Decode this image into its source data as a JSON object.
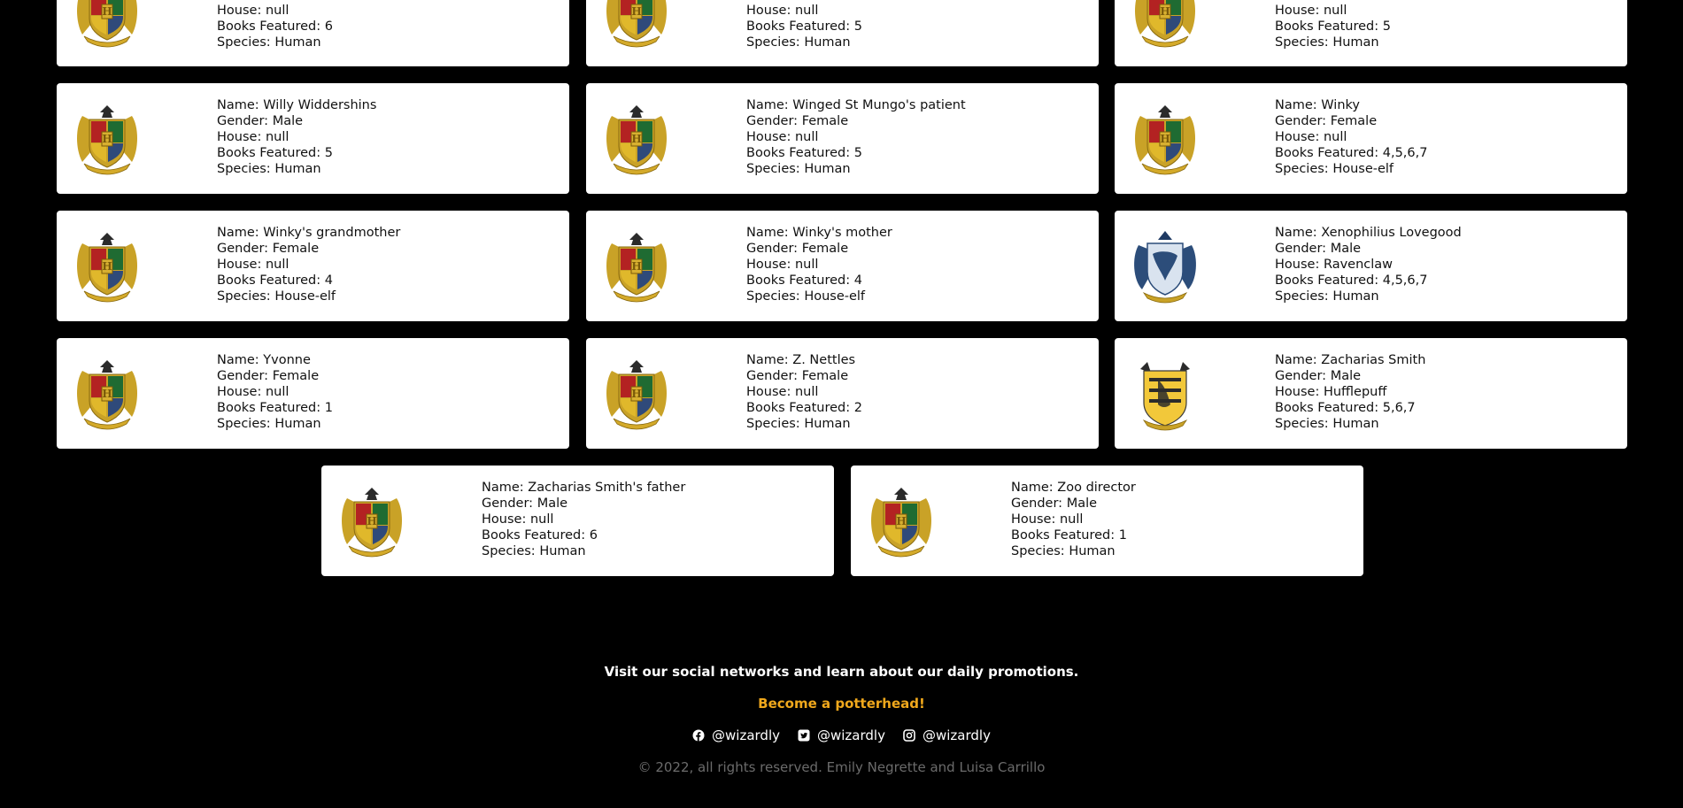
{
  "cards": [
    {
      "name": "",
      "gender": "",
      "house": "null",
      "books": "6",
      "species": "Human",
      "crest": "hogwarts",
      "cut": true
    },
    {
      "name": "",
      "gender": "",
      "house": "null",
      "books": "5",
      "species": "Human",
      "crest": "hogwarts",
      "cut": true
    },
    {
      "name": "",
      "gender": "",
      "house": "null",
      "books": "5",
      "species": "Human",
      "crest": "hogwarts",
      "cut": true
    },
    {
      "name": "Willy Widdershins",
      "gender": "Male",
      "house": "null",
      "books": "5",
      "species": "Human",
      "crest": "hogwarts"
    },
    {
      "name": "Winged St Mungo's patient",
      "gender": "Female",
      "house": "null",
      "books": "5",
      "species": "Human",
      "crest": "hogwarts"
    },
    {
      "name": "Winky",
      "gender": "Female",
      "house": "null",
      "books": "4,5,6,7",
      "species": "House-elf",
      "crest": "hogwarts"
    },
    {
      "name": "Winky's grandmother",
      "gender": "Female",
      "house": "null",
      "books": "4",
      "species": "House-elf",
      "crest": "hogwarts"
    },
    {
      "name": "Winky's mother",
      "gender": "Female",
      "house": "null",
      "books": "4",
      "species": "House-elf",
      "crest": "hogwarts"
    },
    {
      "name": "Xenophilius Lovegood",
      "gender": "Male",
      "house": "Ravenclaw",
      "books": "4,5,6,7",
      "species": "Human",
      "crest": "ravenclaw"
    },
    {
      "name": "Yvonne",
      "gender": "Female",
      "house": "null",
      "books": "1",
      "species": "Human",
      "crest": "hogwarts"
    },
    {
      "name": "Z. Nettles",
      "gender": "Female",
      "house": "null",
      "books": "2",
      "species": "Human",
      "crest": "hogwarts"
    },
    {
      "name": "Zacharias Smith",
      "gender": "Male",
      "house": "Hufflepuff",
      "books": "5,6,7",
      "species": "Human",
      "crest": "hufflepuff"
    },
    {
      "name": "Zacharias Smith's father",
      "gender": "Male",
      "house": "null",
      "books": "6",
      "species": "Human",
      "crest": "hogwarts"
    },
    {
      "name": "Zoo director",
      "gender": "Male",
      "house": "null",
      "books": "1",
      "species": "Human",
      "crest": "hogwarts"
    }
  ],
  "labels": {
    "name": "Name: ",
    "gender": "Gender: ",
    "house": "House: ",
    "books": "Books Featured: ",
    "species": "Species: "
  },
  "footer": {
    "promo": "Visit our social networks and learn about our daily promotions.",
    "cta": "Become a potterhead!",
    "socials": [
      {
        "icon": "facebook-icon",
        "handle": "@wizardly"
      },
      {
        "icon": "twitter-icon",
        "handle": "@wizardly"
      },
      {
        "icon": "instagram-icon",
        "handle": "@wizardly"
      }
    ],
    "copyright": "© 2022, all rights reserved. Emily Negrette and Luisa Carrillo"
  }
}
